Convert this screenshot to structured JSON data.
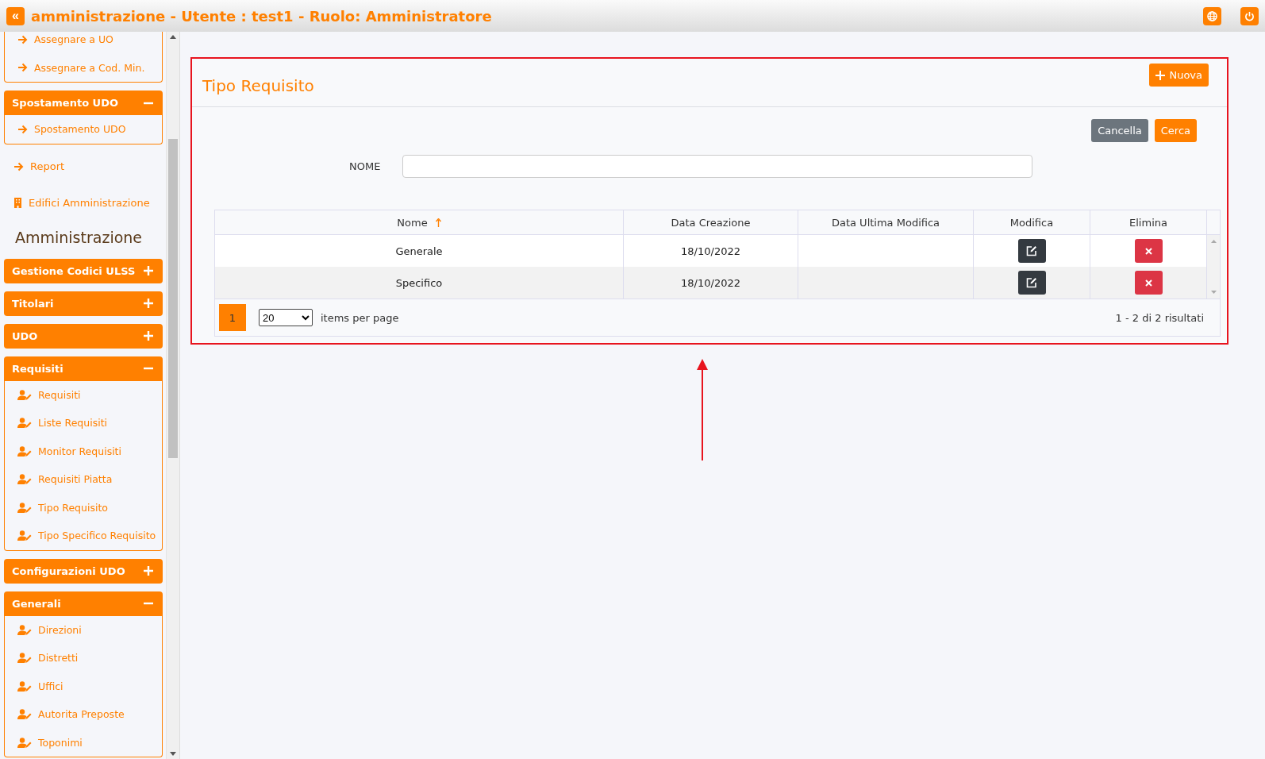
{
  "header": {
    "menu_toggle": "«",
    "title": "amministrazione - Utente : test1 - Ruolo: Amministratore"
  },
  "sidebar": [
    {
      "kind": "box",
      "items": [
        {
          "kind": "arrow",
          "label": "Assegnare a UO"
        },
        {
          "kind": "arrow",
          "label": "Assegnare a Cod. Min."
        }
      ]
    },
    {
      "kind": "group",
      "title": "Spostamento UDO",
      "expanded": true,
      "items": [
        {
          "kind": "arrow",
          "label": "Spostamento UDO"
        }
      ]
    },
    {
      "kind": "link",
      "label": "Report"
    },
    {
      "kind": "building",
      "label": "Edifici Amministrazione"
    },
    {
      "kind": "heading",
      "label": "Amministrazione"
    },
    {
      "kind": "group",
      "title": "Gestione Codici ULSS",
      "expanded": false
    },
    {
      "kind": "group",
      "title": "Titolari",
      "expanded": false
    },
    {
      "kind": "group",
      "title": "UDO",
      "expanded": false
    },
    {
      "kind": "group",
      "title": "Requisiti",
      "expanded": true,
      "items": [
        {
          "kind": "user",
          "label": "Requisiti"
        },
        {
          "kind": "user",
          "label": "Liste Requisiti"
        },
        {
          "kind": "user",
          "label": "Monitor Requisiti"
        },
        {
          "kind": "user",
          "label": "Requisiti Piatta"
        },
        {
          "kind": "user",
          "label": "Tipo Requisito"
        },
        {
          "kind": "user",
          "label": "Tipo Specifico Requisito"
        }
      ]
    },
    {
      "kind": "group",
      "title": "Configurazioni UDO",
      "expanded": false
    },
    {
      "kind": "group",
      "title": "Generali",
      "expanded": true,
      "items": [
        {
          "kind": "user",
          "label": "Direzioni"
        },
        {
          "kind": "user",
          "label": "Distretti"
        },
        {
          "kind": "user",
          "label": "Uffici"
        },
        {
          "kind": "user",
          "label": "Autorita Preposte"
        },
        {
          "kind": "user",
          "label": "Toponimi"
        }
      ]
    }
  ],
  "panel": {
    "title": "Tipo Requisito",
    "new_button": "Nuova",
    "clear_button": "Cancella",
    "search_button": "Cerca",
    "filter": {
      "label": "NOME"
    },
    "table": {
      "columns": [
        {
          "label": "Nome",
          "sorted": true
        },
        {
          "label": "Data Creazione",
          "sorted": false
        },
        {
          "label": "Data Ultima Modifica",
          "sorted": false
        },
        {
          "label": "Modifica",
          "sorted": false
        },
        {
          "label": "Elimina",
          "sorted": false
        }
      ],
      "rows": [
        {
          "nome": "Generale",
          "data_creazione": "18/10/2022"
        },
        {
          "nome": "Specifico",
          "data_creazione": "18/10/2022"
        }
      ]
    },
    "pager": {
      "pages": [
        {
          "label": "1",
          "selected": true
        }
      ],
      "page_size": "20",
      "page_size_label": "items per page",
      "summary": "1 - 2 di 2 risultati"
    }
  }
}
